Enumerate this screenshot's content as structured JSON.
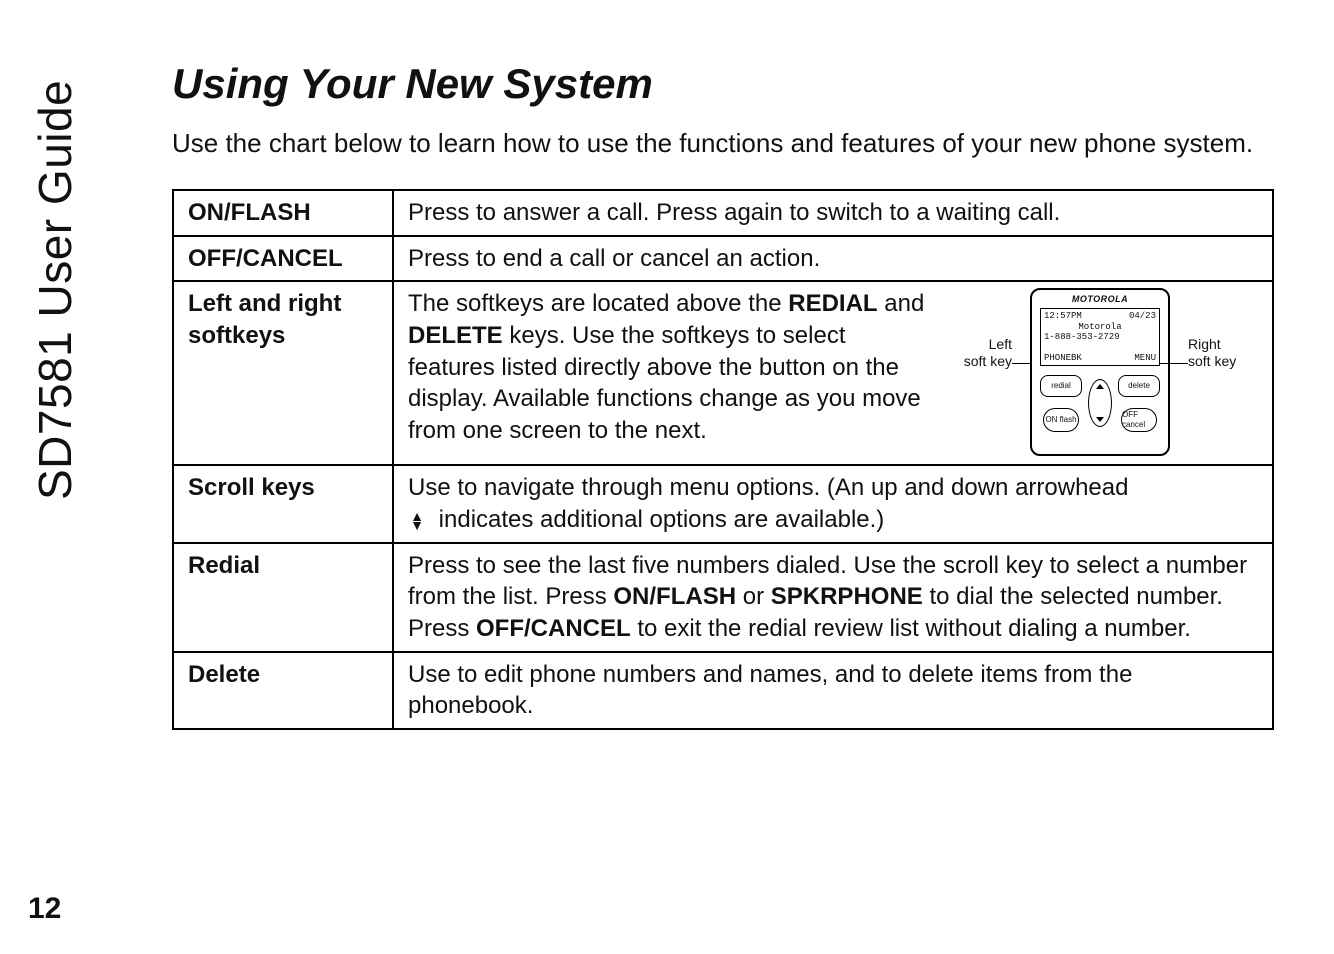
{
  "side_label": "SD7581 User Guide",
  "page_number": "12",
  "title": "Using Your New System",
  "intro": "Use the chart below to learn how to use the functions and features of your new phone system.",
  "rows": {
    "onflash": {
      "label": "ON/FLASH",
      "text": "Press to answer a call. Press again to switch to a waiting call."
    },
    "offcancel": {
      "label": "OFF/CANCEL",
      "text": "Press to end a call or cancel an action."
    },
    "softkeys": {
      "label": "Left and right softkeys",
      "pre": "The softkeys are located above the ",
      "kw1": "REDIAL",
      "mid1": " and ",
      "kw2": "DELETE",
      "post": " keys. Use the softkeys to select features listed directly above the button on the display. Available functions change as you move from one screen to the next."
    },
    "scroll": {
      "label": "Scroll keys",
      "line1": "Use to navigate through menu options. (An up and down arrowhead",
      "line2": " indicates additional options are available.)"
    },
    "redial": {
      "label": "Redial",
      "pre": "Press to see the last five numbers dialed. Use the scroll key to select a number from the list. Press ",
      "kw1": "ON/FLASH",
      "mid1": " or ",
      "kw2": "SPKRPHONE",
      "mid2": " to dial the selected number. Press ",
      "kw3": "OFF/CANCEL",
      "post": " to exit the redial review list without dialing a number."
    },
    "delete": {
      "label": "Delete",
      "text": "Use to edit phone numbers and names, and to delete items from the phonebook."
    }
  },
  "diagram": {
    "left_label_1": "Left",
    "left_label_2": "soft key",
    "right_label_1": "Right",
    "right_label_2": "soft key",
    "brand": "MOTOROLA",
    "screen_time": "12:57PM",
    "screen_date": "04/23",
    "screen_name": "Motorola",
    "screen_number": "1-888-353-2729",
    "screen_left_soft": "PHONEBK",
    "screen_right_soft": "MENU",
    "key_redial": "redial",
    "key_delete": "delete",
    "key_on": "ON flash",
    "key_off": "OFF cancel"
  }
}
